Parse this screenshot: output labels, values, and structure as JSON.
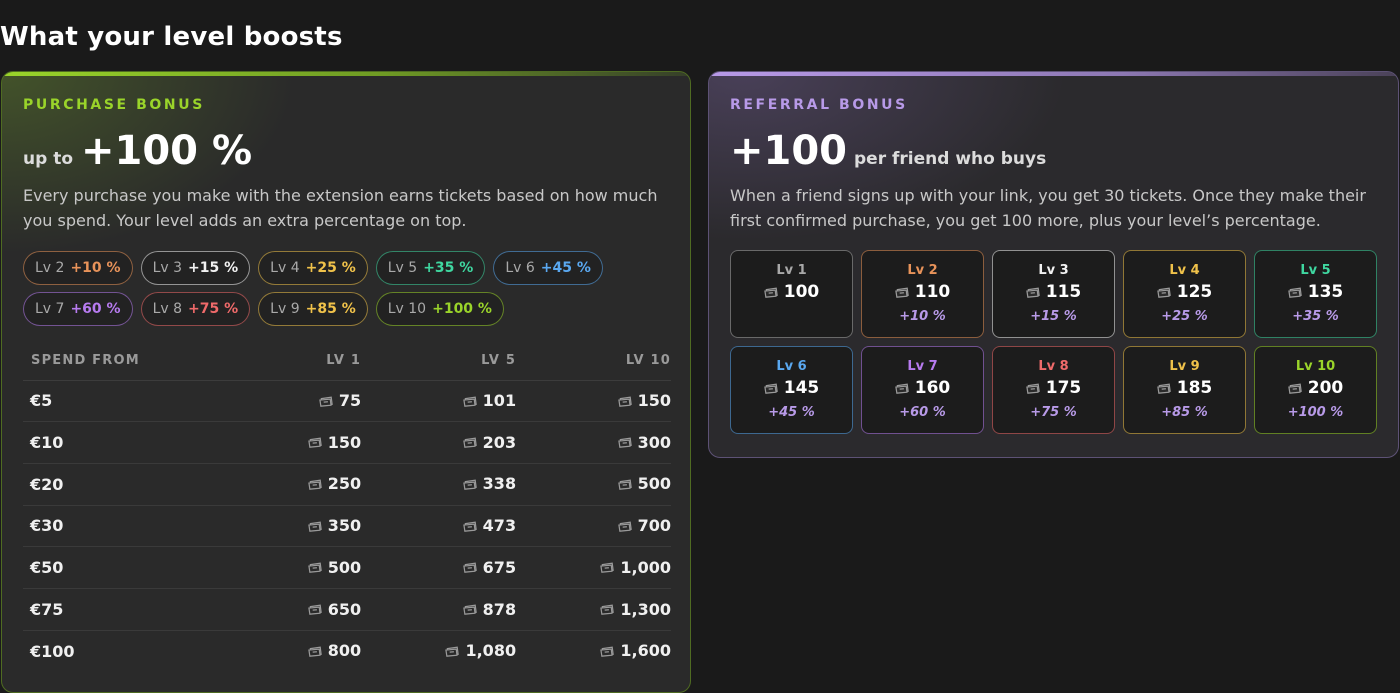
{
  "page": {
    "title": "What your level boosts"
  },
  "purchase": {
    "eyebrow": "PURCHASE BONUS",
    "headline_prefix": "up to",
    "headline_value": "+100 %",
    "description": "Every purchase you make with the extension earns tickets based on how much you spend. Your level adds an extra percentage on top.",
    "pills": [
      {
        "level": "Lv 2",
        "percent": "+10 %",
        "color": "#e8935a"
      },
      {
        "level": "Lv 3",
        "percent": "+15 %",
        "color": "#f2f2f2"
      },
      {
        "level": "Lv 4",
        "percent": "+25 %",
        "color": "#f0c24a"
      },
      {
        "level": "Lv 5",
        "percent": "+35 %",
        "color": "#3fd7a0"
      },
      {
        "level": "Lv 6",
        "percent": "+45 %",
        "color": "#5aa8f0"
      },
      {
        "level": "Lv 7",
        "percent": "+60 %",
        "color": "#b77bf0"
      },
      {
        "level": "Lv 8",
        "percent": "+75 %",
        "color": "#ef6a6a"
      },
      {
        "level": "Lv 9",
        "percent": "+85 %",
        "color": "#f0c24a"
      },
      {
        "level": "Lv 10",
        "percent": "+100 %",
        "color": "#9ad42a"
      }
    ],
    "table": {
      "headers": [
        "SPEND FROM",
        "LV 1",
        "LV 5",
        "LV 10"
      ],
      "rows": [
        [
          "€5",
          "75",
          "101",
          "150"
        ],
        [
          "€10",
          "150",
          "203",
          "300"
        ],
        [
          "€20",
          "250",
          "338",
          "500"
        ],
        [
          "€30",
          "350",
          "473",
          "700"
        ],
        [
          "€50",
          "500",
          "675",
          "1,000"
        ],
        [
          "€75",
          "650",
          "878",
          "1,300"
        ],
        [
          "€100",
          "800",
          "1,080",
          "1,600"
        ]
      ]
    }
  },
  "referral": {
    "eyebrow": "REFERRAL BONUS",
    "headline_value": "+100",
    "headline_suffix": "per friend who buys",
    "description": "When a friend signs up with your link, you get 30 tickets. Once they make their first confirmed purchase, you get 100 more, plus your level’s percentage.",
    "tiles": [
      {
        "level": "Lv 1",
        "tickets": "100",
        "percent": "",
        "color": "#a9a9a9"
      },
      {
        "level": "Lv 2",
        "tickets": "110",
        "percent": "+10 %",
        "color": "#e8935a"
      },
      {
        "level": "Lv 3",
        "tickets": "115",
        "percent": "+15 %",
        "color": "#f2f2f2"
      },
      {
        "level": "Lv 4",
        "tickets": "125",
        "percent": "+25 %",
        "color": "#f0c24a"
      },
      {
        "level": "Lv 5",
        "tickets": "135",
        "percent": "+35 %",
        "color": "#3fd7a0"
      },
      {
        "level": "Lv 6",
        "tickets": "145",
        "percent": "+45 %",
        "color": "#5aa8f0"
      },
      {
        "level": "Lv 7",
        "tickets": "160",
        "percent": "+60 %",
        "color": "#b77bf0"
      },
      {
        "level": "Lv 8",
        "tickets": "175",
        "percent": "+75 %",
        "color": "#ef6a6a"
      },
      {
        "level": "Lv 9",
        "tickets": "185",
        "percent": "+85 %",
        "color": "#f0c24a"
      },
      {
        "level": "Lv 10",
        "tickets": "200",
        "percent": "+100 %",
        "color": "#9ad42a"
      }
    ]
  },
  "icons": {
    "ticket": "ticket-icon"
  },
  "colors": {
    "green_accent": "#9ad42a",
    "purple_accent": "#b89ae8",
    "background": "#1a1a1a"
  }
}
